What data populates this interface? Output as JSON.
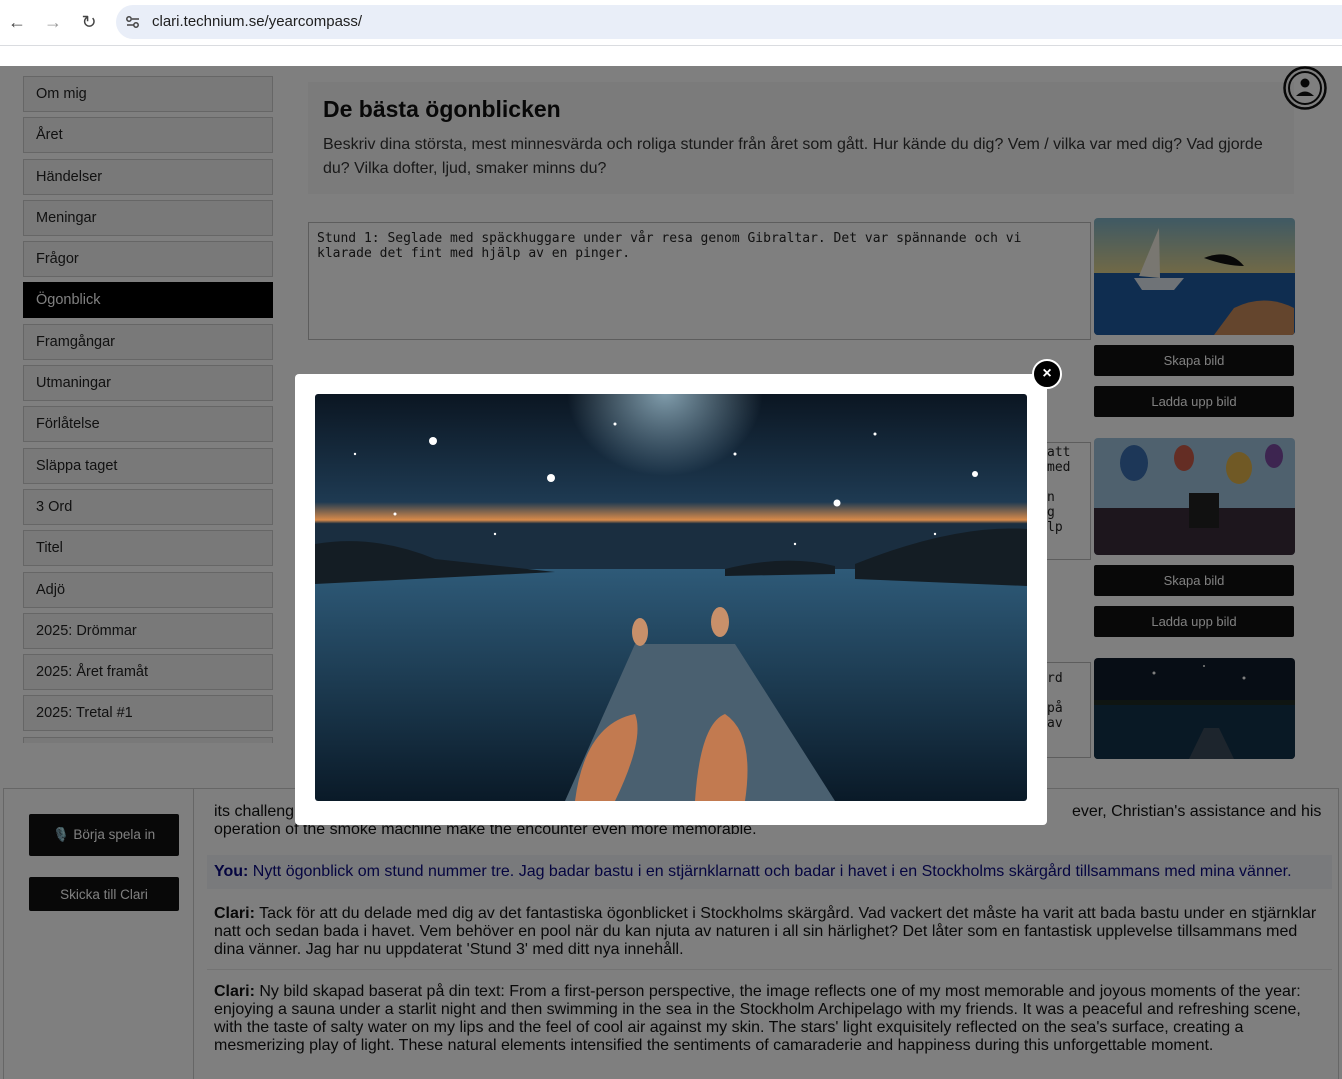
{
  "browser": {
    "url": "clari.technium.se/yearcompass/",
    "back_label": "←",
    "forward_label": "→",
    "reload_label": "↻"
  },
  "sidebar": {
    "items": [
      {
        "label": "Om mig"
      },
      {
        "label": "Året"
      },
      {
        "label": "Händelser"
      },
      {
        "label": "Meningar"
      },
      {
        "label": "Frågor"
      },
      {
        "label": "Ögonblick",
        "active": true
      },
      {
        "label": "Framgångar"
      },
      {
        "label": "Utmaningar"
      },
      {
        "label": "Förlåtelse"
      },
      {
        "label": "Släppa taget"
      },
      {
        "label": "3 Ord"
      },
      {
        "label": "Titel"
      },
      {
        "label": "Adjö"
      },
      {
        "label": "2025: Drömmar"
      },
      {
        "label": "2025: Året framåt"
      },
      {
        "label": "2025: Tretal #1"
      }
    ]
  },
  "intro": {
    "title": "De bästa ögonblicken",
    "description": "Beskriv dina största, mest minnesvärda och roliga stunder från året som gått. Hur kände du dig? Vem / vilka var med dig? Vad gjorde du? Vilka dofter, ljud, smaker minns du?"
  },
  "moments": [
    {
      "text": "Stund 1: Seglade med späckhuggare under vår resa genom Gibraltar. Det var spännande och vi klarade det fint med hjälp av en pinger.",
      "create_label": "Skapa bild",
      "upload_label": "Ladda upp bild"
    },
    {
      "text_visible": "att\nmed\n\nn\ng\nlp",
      "create_label": "Skapa bild",
      "upload_label": "Ladda upp bild"
    },
    {
      "text_visible": "rd\n\npå\nav"
    }
  ],
  "chat": {
    "record_label": "🎙️ Börja spela in",
    "send_label": "Skicka till Clari",
    "partial_top_left": "its challeng",
    "partial_top_right": "ever, Christian's assistance and his",
    "partial_line2": "operation of the smoke machine make the encounter even more memorable.",
    "messages": [
      {
        "speaker": "You:",
        "text": " Nytt ögonblick om stund nummer tre. Jag badar bastu i en stjärnklarnatt och badar i havet i en Stockholms skärgård tillsammans med mina vänner."
      },
      {
        "speaker": "Clari:",
        "text": " Tack för att du delade med dig av det fantastiska ögonblicket i Stockholms skärgård. Vad vackert det måste ha varit att bada bastu under en stjärnklar natt och sedan bada i havet. Vem behöver en pool när du kan njuta av naturen i all sin härlighet? Det låter som en fantastisk upplevelse tillsammans med dina vänner. Jag har nu uppdaterat 'Stund 3' med ditt nya innehåll."
      },
      {
        "speaker": "Clari:",
        "text": " Ny bild skapad baserat på din text: From a first-person perspective, the image reflects one of my most memorable and joyous moments of the year: enjoying a sauna under a starlit night and then swimming in the sea in the Stockholm Archipelago with my friends. It was a peaceful and refreshing scene, with the taste of salty water on my lips and the feel of cool air against my skin. The stars' light exquisitely reflected on the sea's surface, creating a mesmerizing play of light. These natural elements intensified the sentiments of camaraderie and happiness during this unforgettable moment."
      }
    ]
  },
  "modal": {
    "close_label": "×"
  }
}
